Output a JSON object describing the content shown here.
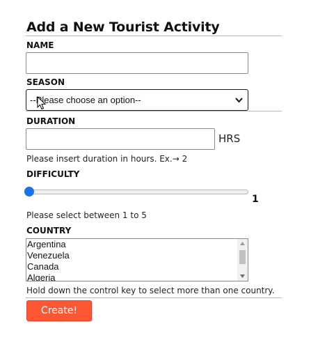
{
  "form": {
    "title": "Add a New Tourist Activity",
    "name": {
      "label": "NAME",
      "value": ""
    },
    "season": {
      "label": "SEASON",
      "selected": "--Please choose an option--"
    },
    "duration": {
      "label": "DURATION",
      "value": "",
      "unit": "HRS",
      "help": "Please insert duration in hours. Ex.→ 2"
    },
    "difficulty": {
      "label": "DIFFICULTY",
      "value": 1,
      "value_text": "1",
      "min": 1,
      "max": 5,
      "help": "Please select between 1 to 5",
      "accent": "#1a73e8"
    },
    "country": {
      "label": "COUNTRY",
      "options": [
        "Argentina",
        "Venezuela",
        "Canada",
        "Algeria"
      ],
      "help": "Hold down the control key to select more than one country."
    },
    "submit": {
      "label": "Create!",
      "color": "#ff5733"
    }
  }
}
